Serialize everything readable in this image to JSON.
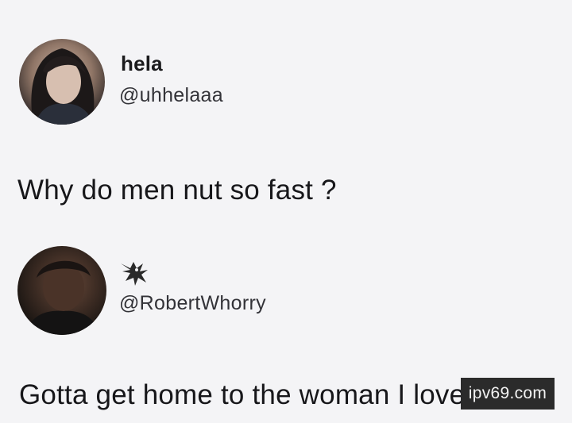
{
  "posts": [
    {
      "display_name": "hela",
      "handle": "@uhhelaaa",
      "text": "Why do men nut so fast ?"
    },
    {
      "name_icon": "eagle-icon",
      "handle": "@RobertWhorry",
      "text": "Gotta get home to the woman I love"
    }
  ],
  "watermark": "ipv69.com",
  "colors": {
    "background": "#f4f4f6",
    "text": "#1b1b1d",
    "watermark_bg": "#2b2b2b"
  }
}
